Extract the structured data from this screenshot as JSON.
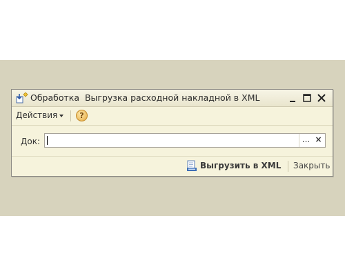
{
  "window": {
    "title_prefix": "Обработка",
    "title": "Выгрузка расходной накладной в XML"
  },
  "toolbar": {
    "actions_label": "Действия",
    "help_label": "?"
  },
  "form": {
    "doc_label": "Док:",
    "doc_value": "",
    "select_button": "...",
    "clear_button": "×"
  },
  "footer": {
    "export_label": "Выгрузить в XML",
    "close_label": "Закрыть"
  },
  "icons": {
    "window": "processing-icon",
    "export": "document-export-icon"
  }
}
